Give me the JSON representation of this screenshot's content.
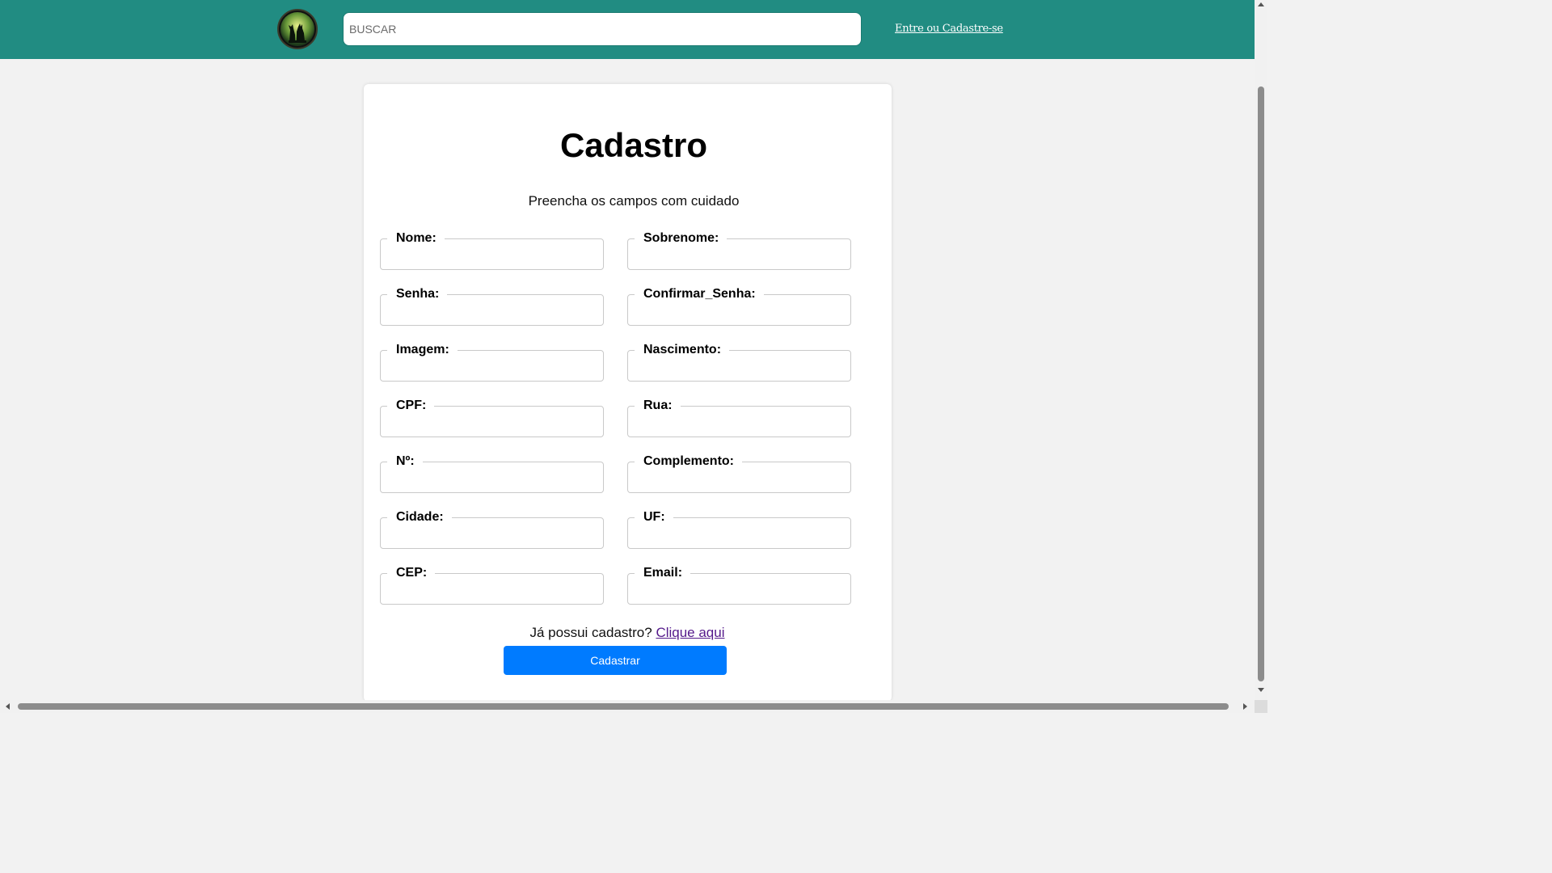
{
  "header": {
    "logo_icon": "cat-dog-silhouette-logo",
    "search_placeholder": "BUSCAR",
    "login_link": "Entre ou Cadastre-se",
    "background_color": "#218c82"
  },
  "form": {
    "title": "Cadastro",
    "subtitle": "Preencha os campos com cuidado",
    "fields": [
      {
        "label": "Nome:"
      },
      {
        "label": "Sobrenome:"
      },
      {
        "label": "Senha:"
      },
      {
        "label": "Confirmar_Senha:"
      },
      {
        "label": "Imagem:"
      },
      {
        "label": "Nascimento:"
      },
      {
        "label": "CPF:"
      },
      {
        "label": "Rua:"
      },
      {
        "label": "Nº:"
      },
      {
        "label": "Complemento:"
      },
      {
        "label": "Cidade:"
      },
      {
        "label": "UF:"
      },
      {
        "label": "CEP:"
      },
      {
        "label": "Email:"
      }
    ],
    "login_prompt": "Já possui cadastro?",
    "login_prompt_link": "Clique aqui",
    "submit_label": "Cadastrar",
    "submit_color": "#007bff"
  }
}
